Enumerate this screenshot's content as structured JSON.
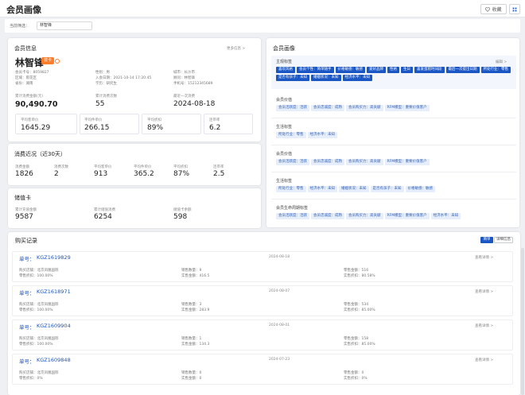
{
  "header": {
    "title": "会员画像",
    "collect_label": "收藏",
    "collect_icon": "heart-icon",
    "grid_icon": "grid-icon"
  },
  "filter": {
    "label": "当前筛选：",
    "value": "林智锋"
  },
  "member_info": {
    "title": "会员信息",
    "more": "更多信息 >",
    "name": "林智锋",
    "badge": "非卡",
    "fields": {
      "member_id": "会员卡号：8059827",
      "gender": "性别：男",
      "city": "城市：长沙市",
      "region": "区域：雨花区",
      "join_date": "入会日期：2021-10-14 17:20:45",
      "advisor": "顾问：林智锋",
      "province": "省份：湖南",
      "education": "学历：研究生",
      "phone": "手机号：15212345689"
    },
    "stats": [
      {
        "label": "累计消费金额(元)",
        "value": "90,490.70"
      },
      {
        "label": "累计消费次数",
        "value": "55"
      },
      {
        "label": "最近一次消费",
        "value": "2024-08-18"
      }
    ],
    "boxes": [
      {
        "label": "平均客单价",
        "value": "1645.29"
      },
      {
        "label": "平均件单价",
        "value": "266.15"
      },
      {
        "label": "平均折扣",
        "value": "89%"
      },
      {
        "label": "连带率",
        "value": "6.2"
      }
    ]
  },
  "recent": {
    "title": "消费近况（近30天）",
    "items": [
      {
        "label": "消费金额",
        "value": "1826"
      },
      {
        "label": "消费次数",
        "value": "2"
      },
      {
        "label": "平均客单价",
        "value": "913"
      },
      {
        "label": "平均件单价",
        "value": "365.2"
      },
      {
        "label": "平均折扣",
        "value": "87%"
      },
      {
        "label": "连带率",
        "value": "2.5"
      }
    ]
  },
  "stored": {
    "title": "储值卡",
    "items": [
      {
        "label": "累计充值金额",
        "value": "9587"
      },
      {
        "label": "累计储值消费",
        "value": "6254"
      },
      {
        "label": "储值卡余额",
        "value": "598"
      }
    ]
  },
  "portrait": {
    "title": "会员画像",
    "main_tags": {
      "title": "主观标签",
      "edit": "编辑 >",
      "tags": [
        "喜欢风格",
        "会员个性：简单随手",
        "价格敏感：敏感",
        "爱好品牌",
        "性格",
        "生日",
        "喜爱蛋糕时间段",
        "最后一次提出日期",
        "所处行业：零售",
        "是否有孩子：未知",
        "婚姻状况：未知",
        "经济水平：未知"
      ]
    },
    "sections": [
      {
        "title": "会员价值",
        "tags": [
          "会员活跃度：活跃",
          "会员忠诚度：成熟",
          "会员购买力：高贡献",
          "RFM模型：重要价值客户"
        ]
      },
      {
        "title": "生活标签",
        "tags": [
          "所处行业：零售",
          "经济水平：未知"
        ]
      },
      {
        "title": "会员价值",
        "tags": [
          "会员活跃度：活跃",
          "会员忠诚度：成熟",
          "会员购买力：高贡献",
          "RFM模型：重要价值客户"
        ]
      },
      {
        "title": "生活标签",
        "tags": [
          "所处行业：零售",
          "经济水平：未知",
          "婚姻状况：未知",
          "是否有孩子：未知",
          "价格敏感：敏感"
        ]
      },
      {
        "title": "会员生命周期标签",
        "tags": [
          "会员活跃度：活跃",
          "会员忠诚度：成熟",
          "会员购买力：高贡献",
          "RFM模型：重要价值客户",
          "经济水平：未知"
        ]
      }
    ]
  },
  "purchases": {
    "title": "购买记录",
    "tabs": [
      "简单",
      "详细信息"
    ],
    "order_label": "单号：",
    "detail_label": "查看详情 >",
    "orders": [
      {
        "no": "KGZ1619829",
        "date": "2024-08-18",
        "store": "购买店铺：北京凤凰国际",
        "discount": "零售折扣：100.00%",
        "qty": "销售数量：9",
        "amount": "实售金额：416.5",
        "retail": "零售金额：516",
        "rate": "实售折扣：80.58%"
      },
      {
        "no": "KGZ1618971",
        "date": "2024-08-07",
        "store": "购买店铺：北京凤凰国际",
        "discount": "零售折扣：100.00%",
        "qty": "销售数量：3",
        "amount": "实售金额：283.9",
        "retail": "零售金额：534",
        "rate": "实售折扣：85.00%"
      },
      {
        "no": "KGZ1609904",
        "date": "2024-08-01",
        "store": "购买店铺：北京凤凰国际",
        "discount": "零售折扣：100.00%",
        "qty": "销售数量：1",
        "amount": "实售金额：134.3",
        "retail": "零售金额：158",
        "rate": "实售折扣：85.00%"
      },
      {
        "no": "KGZ1609848",
        "date": "2024-07-23",
        "store": "购买店铺：北京凤凰国际",
        "discount": "零售折扣：0%",
        "qty": "销售数量：0",
        "amount": "实售金额：0",
        "retail": "零售金额：0",
        "rate": "实售折扣：0%"
      }
    ]
  }
}
